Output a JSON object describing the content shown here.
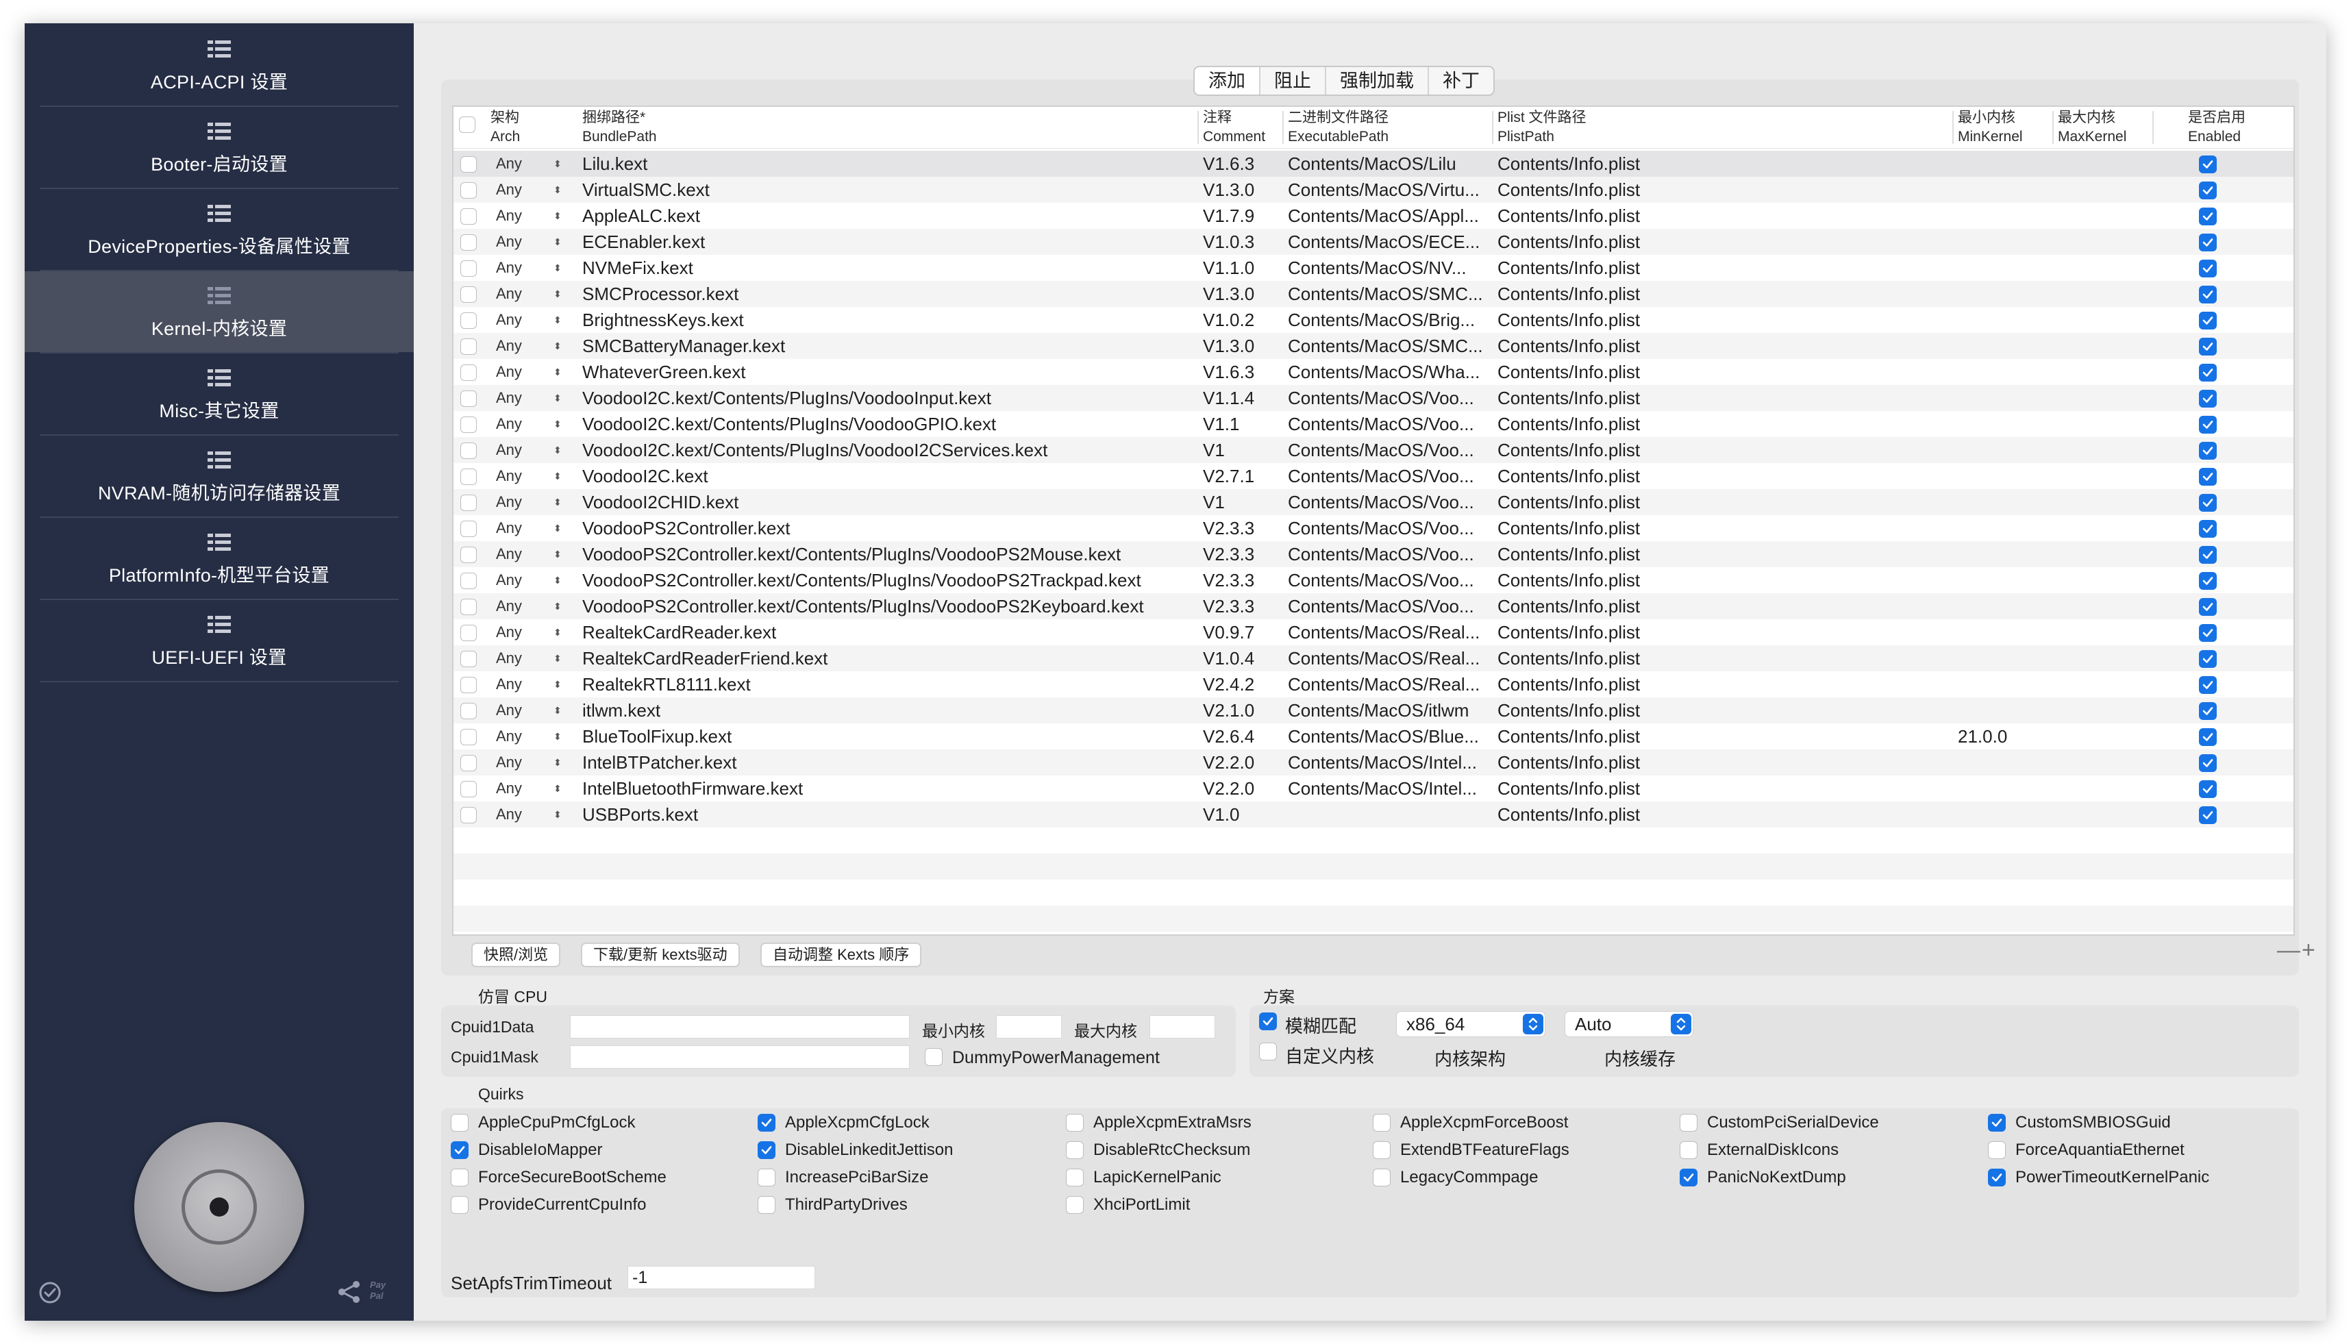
{
  "sidebar": {
    "items": [
      {
        "label": "ACPI-ACPI 设置",
        "selected": false
      },
      {
        "label": "Booter-启动设置",
        "selected": false
      },
      {
        "label": "DeviceProperties-设备属性设置",
        "selected": false
      },
      {
        "label": "Kernel-内核设置",
        "selected": true
      },
      {
        "label": "Misc-其它设置",
        "selected": false
      },
      {
        "label": "NVRAM-随机访问存储器设置",
        "selected": false
      },
      {
        "label": "PlatformInfo-机型平台设置",
        "selected": false
      },
      {
        "label": "UEFI-UEFI 设置",
        "selected": false
      }
    ],
    "icons": {
      "menu": "list-menu-icon",
      "disk": "hard-disk-icon",
      "status": "check-circle-icon",
      "share": "share-icon"
    },
    "paypal_line1": "Pay",
    "paypal_line2": "Pal"
  },
  "tabs": {
    "items": [
      "添加",
      "阻止",
      "强制加载",
      "补丁"
    ],
    "selected": "添加"
  },
  "table": {
    "headers": {
      "arch_cn": "架构",
      "arch_en": "Arch",
      "bundle_cn": "捆绑路径*",
      "bundle_en": "BundlePath",
      "comment_cn": "注释",
      "comment_en": "Comment",
      "exec_cn": "二进制文件路径",
      "exec_en": "ExecutablePath",
      "plist_cn": "Plist 文件路径",
      "plist_en": "PlistPath",
      "mink_cn": "最小内核",
      "mink_en": "MinKernel",
      "maxk_cn": "最大内核",
      "maxk_en": "MaxKernel",
      "enabled_cn": "是否启用",
      "enabled_en": "Enabled"
    },
    "rows": [
      {
        "arch": "Any",
        "bundle": "Lilu.kext",
        "comment": "V1.6.3",
        "exec": "Contents/MacOS/Lilu",
        "plist": "Contents/Info.plist",
        "mink": "",
        "maxk": "",
        "enabled": true
      },
      {
        "arch": "Any",
        "bundle": "VirtualSMC.kext",
        "comment": "V1.3.0",
        "exec": "Contents/MacOS/Virtu...",
        "plist": "Contents/Info.plist",
        "mink": "",
        "maxk": "",
        "enabled": true
      },
      {
        "arch": "Any",
        "bundle": "AppleALC.kext",
        "comment": "V1.7.9",
        "exec": "Contents/MacOS/Appl...",
        "plist": "Contents/Info.plist",
        "mink": "",
        "maxk": "",
        "enabled": true
      },
      {
        "arch": "Any",
        "bundle": "ECEnabler.kext",
        "comment": "V1.0.3",
        "exec": "Contents/MacOS/ECE...",
        "plist": "Contents/Info.plist",
        "mink": "",
        "maxk": "",
        "enabled": true
      },
      {
        "arch": "Any",
        "bundle": "NVMeFix.kext",
        "comment": "V1.1.0",
        "exec": "Contents/MacOS/NV...",
        "plist": "Contents/Info.plist",
        "mink": "",
        "maxk": "",
        "enabled": true
      },
      {
        "arch": "Any",
        "bundle": "SMCProcessor.kext",
        "comment": "V1.3.0",
        "exec": "Contents/MacOS/SMC...",
        "plist": "Contents/Info.plist",
        "mink": "",
        "maxk": "",
        "enabled": true
      },
      {
        "arch": "Any",
        "bundle": "BrightnessKeys.kext",
        "comment": "V1.0.2",
        "exec": "Contents/MacOS/Brig...",
        "plist": "Contents/Info.plist",
        "mink": "",
        "maxk": "",
        "enabled": true
      },
      {
        "arch": "Any",
        "bundle": "SMCBatteryManager.kext",
        "comment": "V1.3.0",
        "exec": "Contents/MacOS/SMC...",
        "plist": "Contents/Info.plist",
        "mink": "",
        "maxk": "",
        "enabled": true
      },
      {
        "arch": "Any",
        "bundle": "WhateverGreen.kext",
        "comment": "V1.6.3",
        "exec": "Contents/MacOS/Wha...",
        "plist": "Contents/Info.plist",
        "mink": "",
        "maxk": "",
        "enabled": true
      },
      {
        "arch": "Any",
        "bundle": "VoodooI2C.kext/Contents/PlugIns/VoodooInput.kext",
        "comment": "V1.1.4",
        "exec": "Contents/MacOS/Voo...",
        "plist": "Contents/Info.plist",
        "mink": "",
        "maxk": "",
        "enabled": true
      },
      {
        "arch": "Any",
        "bundle": "VoodooI2C.kext/Contents/PlugIns/VoodooGPIO.kext",
        "comment": "V1.1",
        "exec": "Contents/MacOS/Voo...",
        "plist": "Contents/Info.plist",
        "mink": "",
        "maxk": "",
        "enabled": true
      },
      {
        "arch": "Any",
        "bundle": "VoodooI2C.kext/Contents/PlugIns/VoodooI2CServices.kext",
        "comment": "V1",
        "exec": "Contents/MacOS/Voo...",
        "plist": "Contents/Info.plist",
        "mink": "",
        "maxk": "",
        "enabled": true
      },
      {
        "arch": "Any",
        "bundle": "VoodooI2C.kext",
        "comment": "V2.7.1",
        "exec": "Contents/MacOS/Voo...",
        "plist": "Contents/Info.plist",
        "mink": "",
        "maxk": "",
        "enabled": true
      },
      {
        "arch": "Any",
        "bundle": "VoodooI2CHID.kext",
        "comment": "V1",
        "exec": "Contents/MacOS/Voo...",
        "plist": "Contents/Info.plist",
        "mink": "",
        "maxk": "",
        "enabled": true
      },
      {
        "arch": "Any",
        "bundle": "VoodooPS2Controller.kext",
        "comment": "V2.3.3",
        "exec": "Contents/MacOS/Voo...",
        "plist": "Contents/Info.plist",
        "mink": "",
        "maxk": "",
        "enabled": true
      },
      {
        "arch": "Any",
        "bundle": "VoodooPS2Controller.kext/Contents/PlugIns/VoodooPS2Mouse.kext",
        "comment": "V2.3.3",
        "exec": "Contents/MacOS/Voo...",
        "plist": "Contents/Info.plist",
        "mink": "",
        "maxk": "",
        "enabled": true
      },
      {
        "arch": "Any",
        "bundle": "VoodooPS2Controller.kext/Contents/PlugIns/VoodooPS2Trackpad.kext",
        "comment": "V2.3.3",
        "exec": "Contents/MacOS/Voo...",
        "plist": "Contents/Info.plist",
        "mink": "",
        "maxk": "",
        "enabled": true
      },
      {
        "arch": "Any",
        "bundle": "VoodooPS2Controller.kext/Contents/PlugIns/VoodooPS2Keyboard.kext",
        "comment": "V2.3.3",
        "exec": "Contents/MacOS/Voo...",
        "plist": "Contents/Info.plist",
        "mink": "",
        "maxk": "",
        "enabled": true
      },
      {
        "arch": "Any",
        "bundle": "RealtekCardReader.kext",
        "comment": "V0.9.7",
        "exec": "Contents/MacOS/Real...",
        "plist": "Contents/Info.plist",
        "mink": "",
        "maxk": "",
        "enabled": true
      },
      {
        "arch": "Any",
        "bundle": "RealtekCardReaderFriend.kext",
        "comment": "V1.0.4",
        "exec": "Contents/MacOS/Real...",
        "plist": "Contents/Info.plist",
        "mink": "",
        "maxk": "",
        "enabled": true
      },
      {
        "arch": "Any",
        "bundle": "RealtekRTL8111.kext",
        "comment": "V2.4.2",
        "exec": "Contents/MacOS/Real...",
        "plist": "Contents/Info.plist",
        "mink": "",
        "maxk": "",
        "enabled": true
      },
      {
        "arch": "Any",
        "bundle": "itlwm.kext",
        "comment": "V2.1.0",
        "exec": "Contents/MacOS/itlwm",
        "plist": "Contents/Info.plist",
        "mink": "",
        "maxk": "",
        "enabled": true
      },
      {
        "arch": "Any",
        "bundle": "BlueToolFixup.kext",
        "comment": "V2.6.4",
        "exec": "Contents/MacOS/Blue...",
        "plist": "Contents/Info.plist",
        "mink": "21.0.0",
        "maxk": "",
        "enabled": true
      },
      {
        "arch": "Any",
        "bundle": "IntelBTPatcher.kext",
        "comment": "V2.2.0",
        "exec": "Contents/MacOS/Intel...",
        "plist": "Contents/Info.plist",
        "mink": "",
        "maxk": "",
        "enabled": true
      },
      {
        "arch": "Any",
        "bundle": "IntelBluetoothFirmware.kext",
        "comment": "V2.2.0",
        "exec": "Contents/MacOS/Intel...",
        "plist": "Contents/Info.plist",
        "mink": "",
        "maxk": "",
        "enabled": true
      },
      {
        "arch": "Any",
        "bundle": "USBPorts.kext",
        "comment": "V1.0",
        "exec": "",
        "plist": "Contents/Info.plist",
        "mink": "",
        "maxk": "",
        "enabled": true
      }
    ]
  },
  "buttons": {
    "snapshot": "快照/浏览",
    "download": "下载/更新 kexts驱动",
    "auto_order": "自动调整 Kexts 顺序",
    "minus_plus": "—+"
  },
  "emulate": {
    "title": "仿冒 CPU",
    "cpuid1data_label": "Cpuid1Data",
    "cpuid1data_value": "",
    "cpuid1mask_label": "Cpuid1Mask",
    "cpuid1mask_value": "",
    "min_kernel_label": "最小内核",
    "min_kernel_value": "",
    "max_kernel_label": "最大内核",
    "max_kernel_value": "",
    "dummy_pm_label": "DummyPowerManagement",
    "dummy_pm_checked": false
  },
  "scheme": {
    "title": "方案",
    "fuzzy_label": "模糊匹配",
    "fuzzy_checked": true,
    "custom_label": "自定义内核",
    "custom_checked": false,
    "arch_value": "x86_64",
    "arch_label": "内核架构",
    "cache_value": "Auto",
    "cache_label": "内核缓存"
  },
  "quirks": {
    "title": "Quirks",
    "columns": [
      [
        {
          "label": "AppleCpuPmCfgLock",
          "checked": false
        },
        {
          "label": "DisableIoMapper",
          "checked": true
        },
        {
          "label": "ForceSecureBootScheme",
          "checked": false
        },
        {
          "label": "ProvideCurrentCpuInfo",
          "checked": false
        }
      ],
      [
        {
          "label": "AppleXcpmCfgLock",
          "checked": true
        },
        {
          "label": "DisableLinkeditJettison",
          "checked": true
        },
        {
          "label": "IncreasePciBarSize",
          "checked": false
        },
        {
          "label": "ThirdPartyDrives",
          "checked": false
        }
      ],
      [
        {
          "label": "AppleXcpmExtraMsrs",
          "checked": false
        },
        {
          "label": "DisableRtcChecksum",
          "checked": false
        },
        {
          "label": "LapicKernelPanic",
          "checked": false
        },
        {
          "label": "XhciPortLimit",
          "checked": false
        }
      ],
      [
        {
          "label": "AppleXcpmForceBoost",
          "checked": false
        },
        {
          "label": "ExtendBTFeatureFlags",
          "checked": false
        },
        {
          "label": "LegacyCommpage",
          "checked": false
        }
      ],
      [
        {
          "label": "CustomPciSerialDevice",
          "checked": false
        },
        {
          "label": "ExternalDiskIcons",
          "checked": false
        },
        {
          "label": "PanicNoKextDump",
          "checked": true
        }
      ],
      [
        {
          "label": "CustomSMBIOSGuid",
          "checked": true
        },
        {
          "label": "ForceAquantiaEthernet",
          "checked": false
        },
        {
          "label": "PowerTimeoutKernelPanic",
          "checked": true
        }
      ]
    ],
    "apfs_label": "SetApfsTrimTimeout",
    "apfs_value": "-1"
  },
  "colors": {
    "sidebar": "#262e45",
    "sidebar_selected": "#4a4f5f",
    "accent": "#1673e6",
    "window": "#ececec"
  }
}
